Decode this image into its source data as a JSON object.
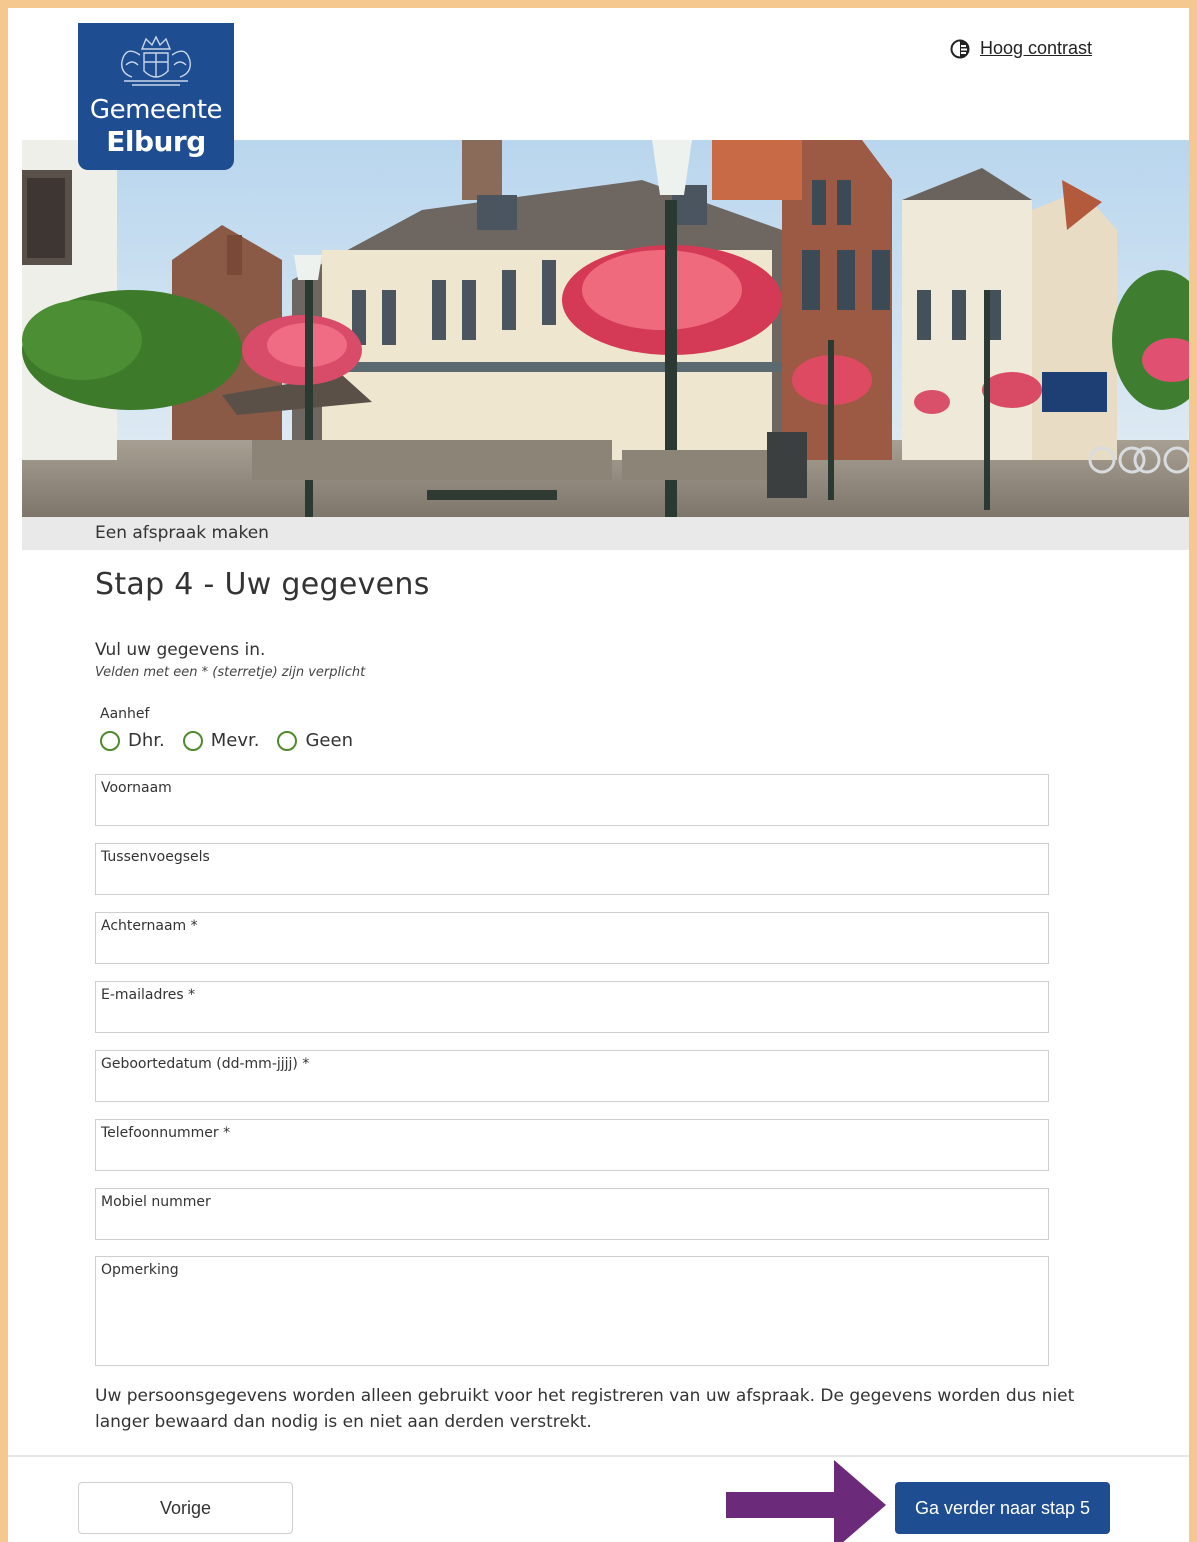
{
  "header": {
    "logo_line1": "Gemeente",
    "logo_line2": "Elburg",
    "contrast_link": "Hoog contrast"
  },
  "breadcrumb": "Een afspraak maken",
  "page_title": "Stap 4 - Uw gegevens",
  "intro": "Vul uw gegevens in.",
  "required_note": "Velden met een * (sterretje) zijn verplicht",
  "salutation": {
    "label": "Aanhef",
    "options": [
      "Dhr.",
      "Mevr.",
      "Geen"
    ]
  },
  "fields": {
    "voornaam": "Voornaam",
    "tussenvoegsels": "Tussenvoegsels",
    "achternaam": "Achternaam *",
    "email": "E-mailadres *",
    "geboortedatum": "Geboortedatum (dd-mm-jjjj) *",
    "telefoon": "Telefoonnummer *",
    "mobiel": "Mobiel nummer",
    "opmerking": "Opmerking"
  },
  "privacy_text": "Uw persoonsgegevens worden alleen gebruikt voor het registreren van uw afspraak. De gegevens worden dus niet langer bewaard dan nodig is en niet aan derden verstrekt.",
  "buttons": {
    "previous": "Vorige",
    "next": "Ga verder naar stap 5"
  },
  "colors": {
    "brand_blue": "#1f4d91",
    "frame_orange": "#f5c88f",
    "arrow_purple": "#6b2a7a",
    "radio_green": "#4f8a2c"
  }
}
